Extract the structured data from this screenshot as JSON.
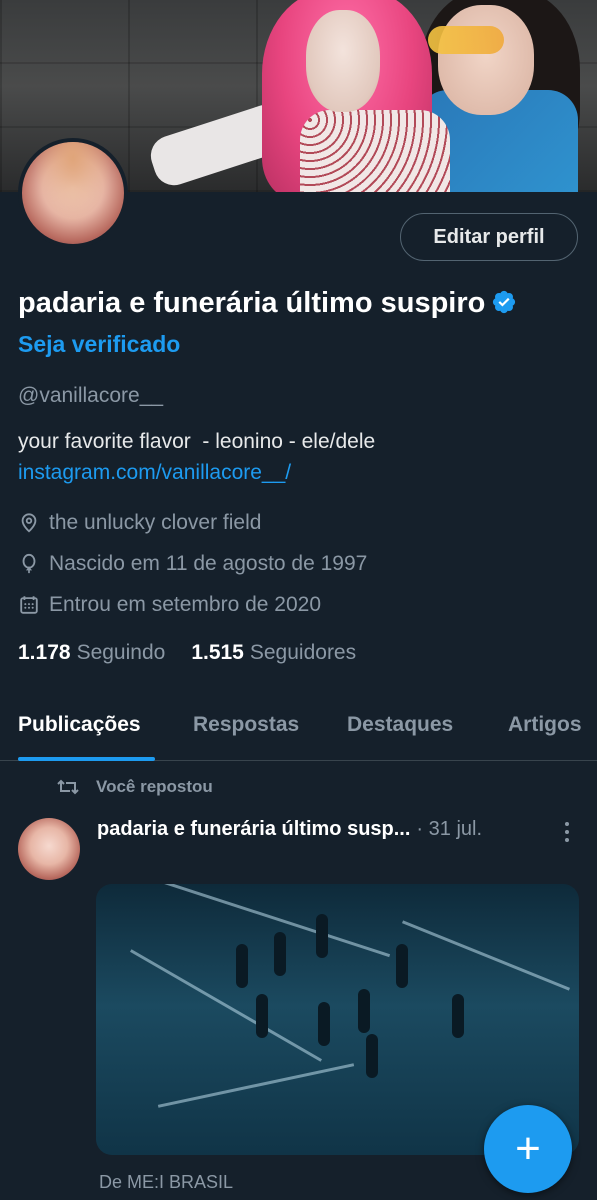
{
  "profile": {
    "edit_label": "Editar perfil",
    "name": "padaria e funerária último suspiro",
    "get_verified": "Seja verificado",
    "handle": "@vanillacore__",
    "bio": "your favorite flavor  - leonino - ele/dele",
    "link": "instagram.com/vanillacore__/",
    "location": "the unlucky clover field",
    "birthday": "Nascido em 11 de agosto de 1997",
    "joined": "Entrou em setembro de 2020",
    "following_count": "1.178",
    "following_label": "Seguindo",
    "followers_count": "1.515",
    "followers_label": "Seguidores"
  },
  "tabs": [
    {
      "label": "Publicações",
      "active": true
    },
    {
      "label": "Respostas",
      "active": false
    },
    {
      "label": "Destaques",
      "active": false
    },
    {
      "label": "Artigos",
      "active": false
    }
  ],
  "post": {
    "repost_label": "Você repostou",
    "author": "padaria e funerária último susp...",
    "date": "· 31 jul.",
    "source": "De ME:I BRASIL"
  },
  "colors": {
    "background": "#15202b",
    "accent": "#1d9bf0",
    "muted_text": "#8b98a5"
  },
  "icons": {
    "location": "location-pin-icon",
    "birthday": "balloon-icon",
    "joined": "calendar-icon",
    "verified": "verified-badge-icon",
    "repost": "repost-icon",
    "more": "more-vertical-icon",
    "fab": "plus-icon"
  }
}
